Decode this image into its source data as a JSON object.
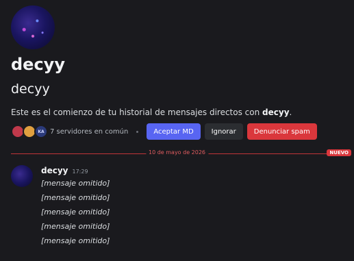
{
  "profile": {
    "display_name": "decyy",
    "username": "decyy",
    "intro_prefix": "Este es el comienzo de tu historial de mensajes directos con ",
    "intro_name": "decyy",
    "intro_suffix": "."
  },
  "mutuals": {
    "guild_badge_text": "KA",
    "text": "7 servidores en común"
  },
  "actions": {
    "accept": "Aceptar MD",
    "ignore": "Ignorar",
    "report_spam": "Denunciar spam"
  },
  "divider": {
    "date": "10 de mayo de 2026",
    "badge": "NUEVO"
  },
  "message": {
    "author": "decyy",
    "time": "17:29",
    "lines": [
      "[mensaje omitido]",
      "[mensaje omitido]",
      "[mensaje omitido]",
      "[mensaje omitido]",
      "[mensaje omitido]"
    ]
  }
}
